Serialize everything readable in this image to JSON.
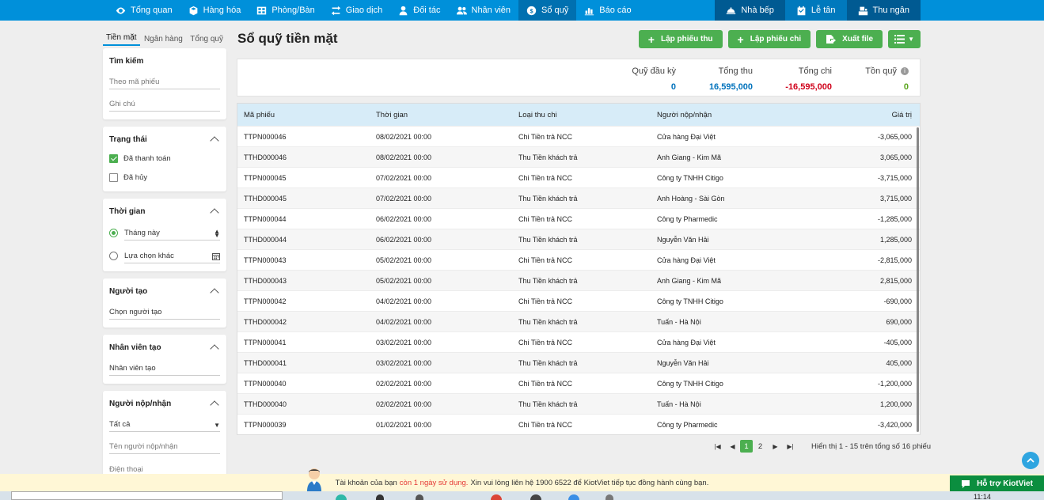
{
  "nav": {
    "left": [
      {
        "label": "Tổng quan",
        "icon": "eye-icon"
      },
      {
        "label": "Hàng hóa",
        "icon": "box-icon"
      },
      {
        "label": "Phòng/Bàn",
        "icon": "table-grid-icon"
      },
      {
        "label": "Giao dịch",
        "icon": "exchange-icon"
      },
      {
        "label": "Đối tác",
        "icon": "user-icon"
      },
      {
        "label": "Nhân viên",
        "icon": "users-icon"
      },
      {
        "label": "Sổ quỹ",
        "icon": "coin-icon",
        "active": true
      },
      {
        "label": "Báo cáo",
        "icon": "chart-icon"
      }
    ],
    "right": [
      {
        "label": "Nhà bếp",
        "icon": "cloche-icon"
      },
      {
        "label": "Lễ tân",
        "icon": "calendar-check-icon"
      },
      {
        "label": "Thu ngân",
        "icon": "cashier-icon"
      }
    ]
  },
  "sidebar": {
    "tabs": [
      "Tiền mặt",
      "Ngân hàng",
      "Tổng quỹ"
    ],
    "search": {
      "title": "Tìm kiếm",
      "placeholder_code": "Theo mã phiếu",
      "placeholder_note": "Ghi chú"
    },
    "status": {
      "title": "Trạng thái",
      "options": [
        {
          "label": "Đã thanh toán",
          "checked": true
        },
        {
          "label": "Đã hủy",
          "checked": false
        }
      ]
    },
    "time": {
      "title": "Thời gian",
      "option_month": "Tháng này",
      "option_other": "Lựa chọn khác"
    },
    "creator": {
      "title": "Người tạo",
      "placeholder": "Chọn người tạo"
    },
    "staff": {
      "title": "Nhân viên tạo",
      "placeholder": "Nhân viên tạo"
    },
    "payer": {
      "title": "Người nộp/nhận",
      "select_value": "Tất cả",
      "placeholder_name": "Tên người nộp/nhận",
      "placeholder_phone": "Điện thoại"
    }
  },
  "main": {
    "title": "Sổ quỹ tiền mặt",
    "buttons": {
      "receipt": "Lập phiếu thu",
      "payment": "Lập phiếu chi",
      "export": "Xuất file"
    },
    "summary": {
      "opening_label": "Quỹ đầu kỳ",
      "opening_value": "0",
      "income_label": "Tổng thu",
      "income_value": "16,595,000",
      "expense_label": "Tổng chi",
      "expense_value": "-16,595,000",
      "balance_label": "Tồn quỹ",
      "balance_value": "0"
    },
    "columns": [
      "Mã phiếu",
      "Thời gian",
      "Loại thu chi",
      "Người nộp/nhận",
      "Giá trị"
    ],
    "rows": [
      [
        "TTPN000046",
        "08/02/2021 00:00",
        "Chi Tiền trả NCC",
        "Cửa hàng Đại Việt",
        "-3,065,000"
      ],
      [
        "TTHD000046",
        "08/02/2021 00:00",
        "Thu Tiền khách trả",
        "Anh Giang - Kim Mã",
        "3,065,000"
      ],
      [
        "TTPN000045",
        "07/02/2021 00:00",
        "Chi Tiền trả NCC",
        "Công ty TNHH Citigo",
        "-3,715,000"
      ],
      [
        "TTHD000045",
        "07/02/2021 00:00",
        "Thu Tiền khách trả",
        "Anh Hoàng - Sài Gòn",
        "3,715,000"
      ],
      [
        "TTPN000044",
        "06/02/2021 00:00",
        "Chi Tiền trả NCC",
        "Công ty Pharmedic",
        "-1,285,000"
      ],
      [
        "TTHD000044",
        "06/02/2021 00:00",
        "Thu Tiền khách trả",
        "Nguyễn Văn Hải",
        "1,285,000"
      ],
      [
        "TTPN000043",
        "05/02/2021 00:00",
        "Chi Tiền trả NCC",
        "Cửa hàng Đại Việt",
        "-2,815,000"
      ],
      [
        "TTHD000043",
        "05/02/2021 00:00",
        "Thu Tiền khách trả",
        "Anh Giang - Kim Mã",
        "2,815,000"
      ],
      [
        "TTPN000042",
        "04/02/2021 00:00",
        "Chi Tiền trả NCC",
        "Công ty TNHH Citigo",
        "-690,000"
      ],
      [
        "TTHD000042",
        "04/02/2021 00:00",
        "Thu Tiền khách trả",
        "Tuấn - Hà Nội",
        "690,000"
      ],
      [
        "TTPN000041",
        "03/02/2021 00:00",
        "Chi Tiền trả NCC",
        "Cửa hàng Đại Việt",
        "-405,000"
      ],
      [
        "TTHD000041",
        "03/02/2021 00:00",
        "Thu Tiền khách trả",
        "Nguyễn Văn Hải",
        "405,000"
      ],
      [
        "TTPN000040",
        "02/02/2021 00:00",
        "Chi Tiền trả NCC",
        "Công ty TNHH Citigo",
        "-1,200,000"
      ],
      [
        "TTHD000040",
        "02/02/2021 00:00",
        "Thu Tiền khách trả",
        "Tuấn - Hà Nội",
        "1,200,000"
      ],
      [
        "TTPN000039",
        "01/02/2021 00:00",
        "Chi Tiền trả NCC",
        "Công ty Pharmedic",
        "-3,420,000"
      ]
    ],
    "pager": {
      "pages": [
        "1",
        "2"
      ],
      "current": "1",
      "info": "Hiển thị 1 - 15 trên tổng số 16 phiếu"
    }
  },
  "notice": {
    "prefix": "Tài khoản của bạn",
    "warning": "còn 1 ngày sử dụng.",
    "suffix": "Xin vui lòng liên hệ 1900 6522 để KiotViet tiếp tục đồng hành cùng bạn."
  },
  "support": {
    "label": "Hỗ trợ KiotViet"
  },
  "taskbar": {
    "time": "11:14"
  },
  "colors": {
    "nav": "#0090da",
    "green": "#4caf50",
    "income": "#0072bc",
    "expense": "#d0021b",
    "balance": "#5aa51d"
  }
}
